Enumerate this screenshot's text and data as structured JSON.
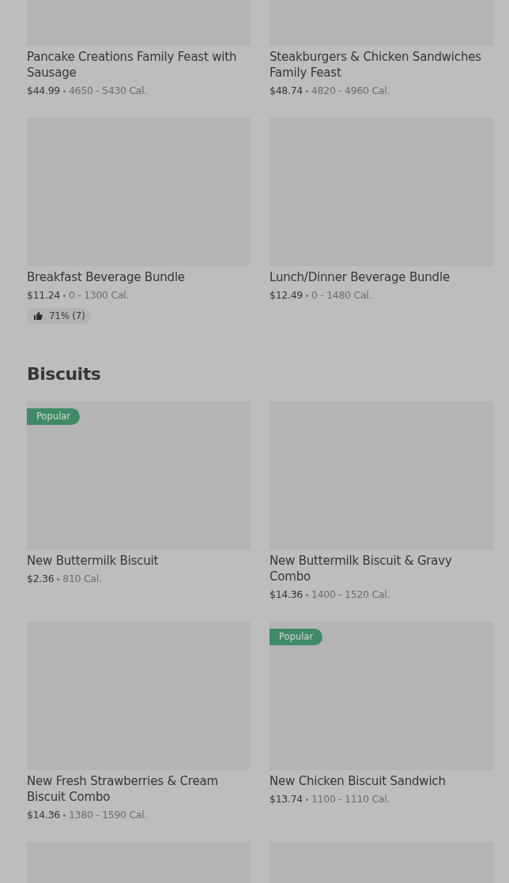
{
  "sections": [
    {
      "items": [
        {
          "kind": "item",
          "name": "Pancake Creations Family Feast with Sausage",
          "price": "$44.99",
          "calories": "4650 - 5430 Cal."
        },
        {
          "kind": "item",
          "name": "Steakburgers & Chicken Sandwiches Family Feast",
          "price": "$48.74",
          "calories": "4820 - 4960 Cal."
        },
        {
          "kind": "item",
          "name": "Breakfast Beverage Bundle",
          "price": "$11.24",
          "calories": "0 - 1300 Cal.",
          "rating": "71% (7)"
        },
        {
          "kind": "item",
          "name": "Lunch/Dinner Beverage Bundle",
          "price": "$12.49",
          "calories": "0 - 1480 Cal."
        }
      ]
    },
    {
      "title": "Biscuits",
      "items": [
        {
          "kind": "item",
          "badge": "Popular",
          "name": "New Buttermilk Biscuit",
          "price": "$2.36",
          "calories": "810 Cal."
        },
        {
          "kind": "item",
          "name": "New Buttermilk Biscuit & Gravy Combo",
          "price": "$14.36",
          "calories": "1400 - 1520 Cal."
        },
        {
          "kind": "item",
          "name": "New Fresh Strawberries & Cream Biscuit Combo",
          "price": "$14.36",
          "calories": "1380 - 1590 Cal."
        },
        {
          "kind": "item",
          "badge": "Popular",
          "name": "New Chicken Biscuit Sandwich",
          "price": "$13.74",
          "calories": "1100 - 1110 Cal."
        },
        {
          "kind": "picture"
        },
        {
          "kind": "picture"
        }
      ]
    }
  ]
}
